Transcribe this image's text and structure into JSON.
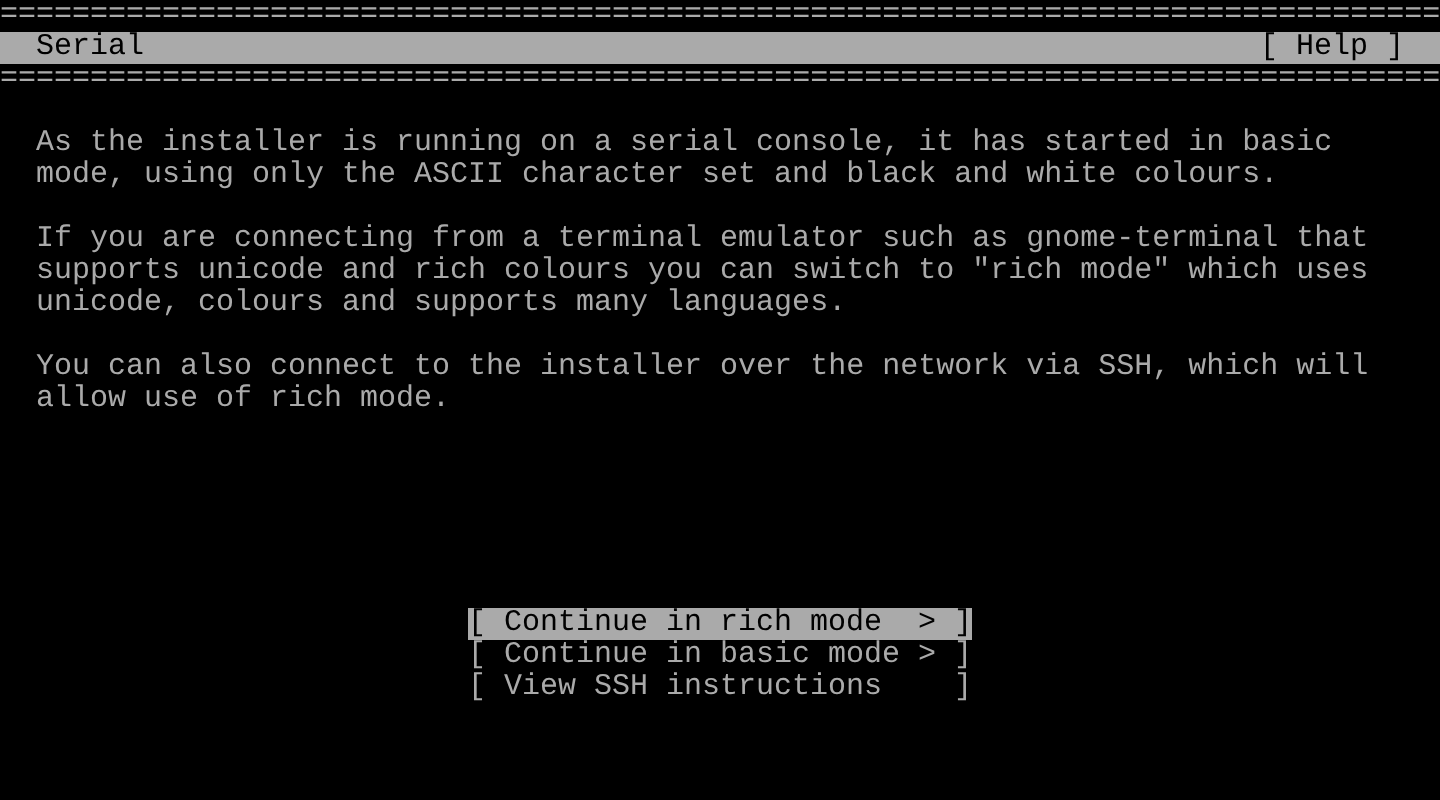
{
  "rule_top": "================================================================================",
  "header": {
    "title": "Serial",
    "help": "[ Help ]"
  },
  "rule_bottom": "================================================================================",
  "paragraphs": [
    "As the installer is running on a serial console, it has started in basic\nmode, using only the ASCII character set and black and white colours.",
    "If you are connecting from a terminal emulator such as gnome-terminal that\nsupports unicode and rich colours you can switch to \"rich mode\" which uses\nunicode, colours and supports many languages.",
    "You can also connect to the installer over the network via SSH, which will\nallow use of rich mode."
  ],
  "buttons": [
    {
      "open": "[",
      "label": "Continue in rich mode",
      "arrow": ">",
      "close": "]",
      "selected": true
    },
    {
      "open": "[",
      "label": "Continue in basic mode",
      "arrow": ">",
      "close": "]",
      "selected": false
    },
    {
      "open": "[",
      "label": "View SSH instructions",
      "close": "]",
      "selected": false
    }
  ]
}
